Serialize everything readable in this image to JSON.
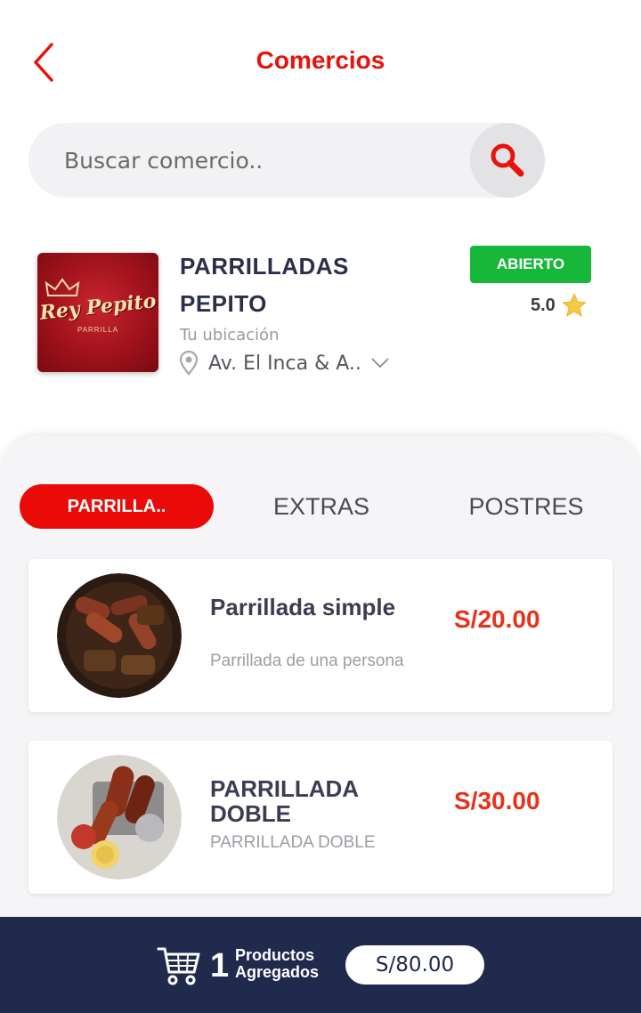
{
  "header": {
    "title": "Comercios",
    "back_icon": "chevron-left-icon"
  },
  "search": {
    "placeholder": "Buscar comercio..",
    "value": "",
    "icon": "search-icon"
  },
  "store": {
    "name_line1": "PARRILLADAS",
    "name_line2": "PEPITO",
    "logo_text": "Rey Pepito",
    "logo_subtitle": "PARRILLA",
    "status": "ABIERTO",
    "status_color": "#17b83a",
    "rating": "5.0",
    "location_label": "Tu ubicación",
    "address": "Av. El Inca & A.."
  },
  "tabs": [
    {
      "label": "PARRILLA..",
      "active": true
    },
    {
      "label": "EXTRAS",
      "active": false
    },
    {
      "label": "POSTRES",
      "active": false
    }
  ],
  "products": [
    {
      "title": "Parrillada simple",
      "description": "Parrillada de una persona",
      "price": "S/20.00"
    },
    {
      "title": "PARRILLADA DOBLE",
      "description": "PARRILLADA DOBLE",
      "price": "S/30.00"
    }
  ],
  "cart": {
    "count": "1",
    "label_line1": "Productos",
    "label_line2": "Agregados",
    "total": "S/80.00",
    "icon": "cart-icon"
  },
  "colors": {
    "accent": "#e8120c",
    "tab_active": "#ea0a08",
    "price": "#e8321c",
    "cart_bar": "#202a4d"
  }
}
